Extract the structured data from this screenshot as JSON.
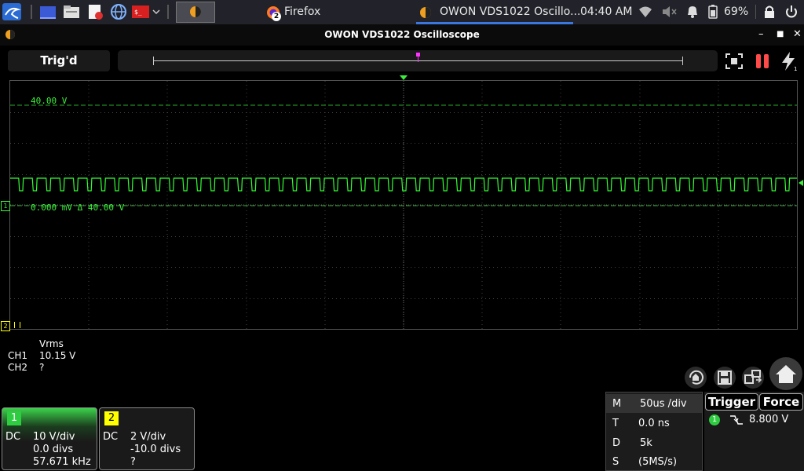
{
  "taskbar": {
    "firefox_label": "Firefox",
    "firefox_badge": "2",
    "active_window_label": "OWON VDS1022 Oscillo...",
    "clock": "04:40 AM",
    "battery_percent": "69%"
  },
  "window": {
    "title": "OWON VDS1022 Oscilloscope",
    "min_glyph": "–",
    "max_glyph": "■",
    "close_glyph": "✕"
  },
  "status": {
    "trigger_state": "Trig'd"
  },
  "scope": {
    "upper_level_label": "40.00 V",
    "lower_level_label": "0.000 mV Δ 40.00 V",
    "ch1_marker": "1",
    "ch2_marker": "2",
    "colors": {
      "trace": "#33ff33",
      "grid": "#444444",
      "level_line": "#2aaa2a"
    }
  },
  "measurements": {
    "header": "Vrms",
    "rows": [
      {
        "channel": "CH1",
        "value": "10.15 V"
      },
      {
        "channel": "CH2",
        "value": "?"
      }
    ]
  },
  "channels": [
    {
      "num": "1",
      "coupling": "DC",
      "scale": "10 V/div",
      "offset": "0.0 divs",
      "freq": "57.671 kHz",
      "color": "#2ecc40"
    },
    {
      "num": "2",
      "coupling": "DC",
      "scale": "2 V/div",
      "offset": "-10.0 divs",
      "freq": "?",
      "color": "#ffff00"
    }
  ],
  "timebase": [
    {
      "key": "M",
      "value": "50us /div"
    },
    {
      "key": "T",
      "value": "0.0 ns"
    },
    {
      "key": "D",
      "value": "5k"
    },
    {
      "key": "S",
      "value": "(5MS/s)"
    }
  ],
  "trigger": {
    "trigger_button": "Trigger",
    "force_button": "Force",
    "source": "1",
    "level": "8.800 V"
  }
}
